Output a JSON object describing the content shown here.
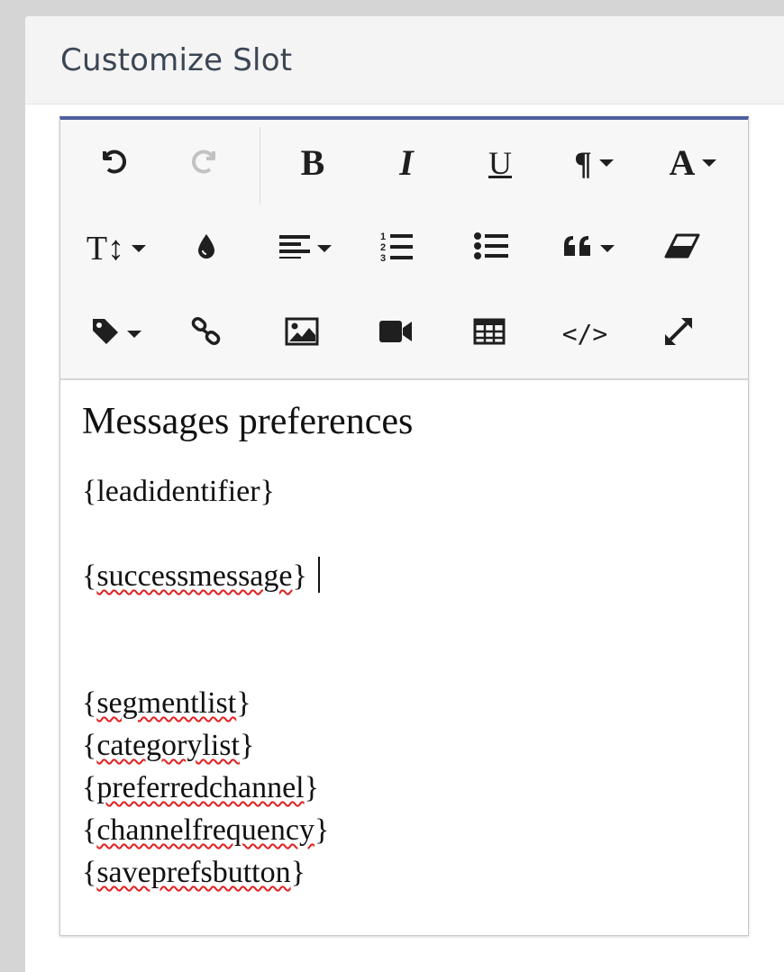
{
  "panel": {
    "title": "Customize Slot"
  },
  "toolbar": {
    "row1": [
      {
        "name": "undo",
        "icon": "undo-icon"
      },
      {
        "name": "redo",
        "icon": "redo-icon",
        "disabled": true
      },
      {
        "name": "bold",
        "icon": "bold-icon",
        "glyph": "B"
      },
      {
        "name": "italic",
        "icon": "italic-icon",
        "glyph": "I"
      },
      {
        "name": "underline",
        "icon": "underline-icon",
        "glyph": "U"
      },
      {
        "name": "paragraph",
        "icon": "paragraph-icon",
        "glyph": "¶"
      },
      {
        "name": "font",
        "icon": "font-icon",
        "glyph": "A"
      }
    ],
    "row2": [
      {
        "name": "font-size",
        "icon": "text-height-icon",
        "glyph": "T↕"
      },
      {
        "name": "color",
        "icon": "droplet-icon"
      },
      {
        "name": "align",
        "icon": "align-left-icon"
      },
      {
        "name": "ordered-list",
        "icon": "ordered-list-icon"
      },
      {
        "name": "unordered-list",
        "icon": "unordered-list-icon"
      },
      {
        "name": "quote",
        "icon": "quote-icon"
      },
      {
        "name": "clear-format",
        "icon": "eraser-icon"
      }
    ],
    "row3": [
      {
        "name": "tag",
        "icon": "tag-icon"
      },
      {
        "name": "link",
        "icon": "link-icon"
      },
      {
        "name": "image",
        "icon": "image-icon"
      },
      {
        "name": "video",
        "icon": "video-icon"
      },
      {
        "name": "table",
        "icon": "table-icon"
      },
      {
        "name": "code-view",
        "icon": "code-icon",
        "glyph": "</>"
      },
      {
        "name": "fullscreen",
        "icon": "expand-icon"
      }
    ]
  },
  "content": {
    "heading": "Messages preferences",
    "lead_identifier": "{leadidentifier}",
    "success_open": "{",
    "success_word": "successmessage",
    "success_close": "}",
    "tokens": [
      {
        "open": "{",
        "word": "segmentlist",
        "close": "}"
      },
      {
        "open": "{",
        "word": "categorylist",
        "close": "}"
      },
      {
        "open": "{",
        "word": "preferredchannel",
        "close": "}"
      },
      {
        "open": "{",
        "word": "channelfrequency",
        "close": "}"
      },
      {
        "open": "{",
        "word": "saveprefsbutton",
        "close": "}"
      }
    ]
  },
  "colors": {
    "editor_top_border": "#4e5e9e",
    "spellcheck": "#e02020",
    "disabled_icon": "#c2c2c2"
  }
}
